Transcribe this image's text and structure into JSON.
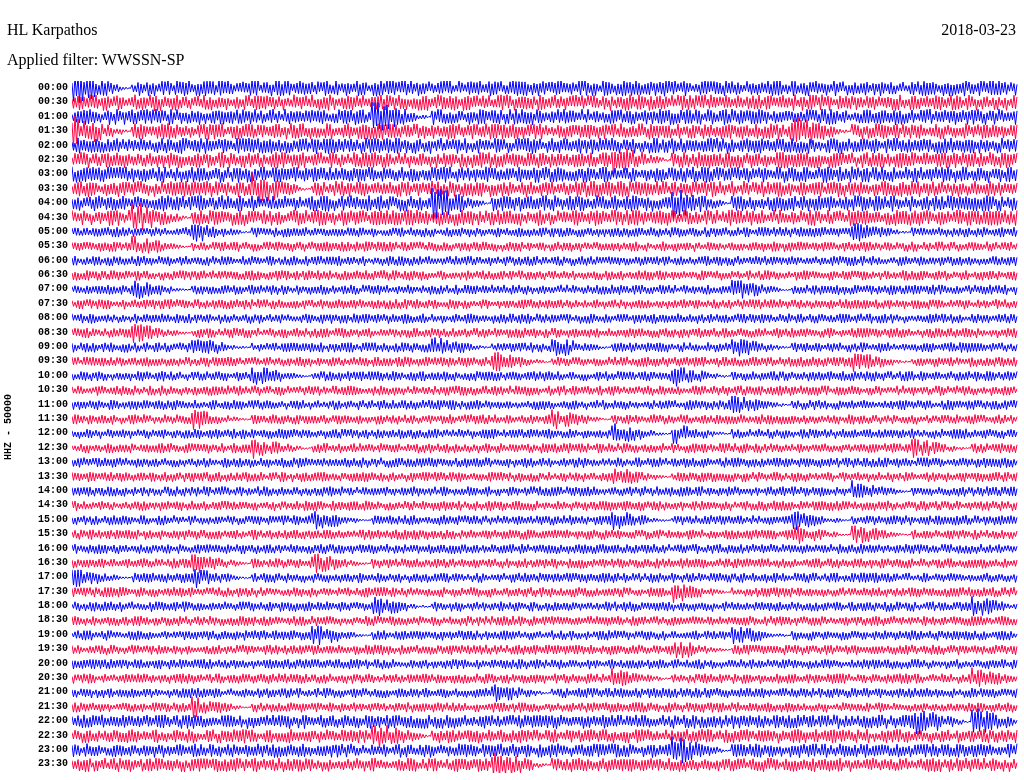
{
  "station": "HL Karpathos",
  "date": "2018-03-23",
  "filter": "Applied filter: WWSSN-SP",
  "axis_label": "HHZ - 50000",
  "traces": [
    {
      "time": "00:00",
      "color": "#0000ff"
    },
    {
      "time": "00:30",
      "color": "#ff0040"
    },
    {
      "time": "01:00",
      "color": "#0000ff"
    },
    {
      "time": "01:30",
      "color": "#ff0040"
    },
    {
      "time": "02:00",
      "color": "#0000ff"
    },
    {
      "time": "02:30",
      "color": "#ff0040"
    },
    {
      "time": "03:00",
      "color": "#0000ff"
    },
    {
      "time": "03:30",
      "color": "#ff0040"
    },
    {
      "time": "04:00",
      "color": "#0000ff"
    },
    {
      "time": "04:30",
      "color": "#ff0040"
    },
    {
      "time": "05:00",
      "color": "#0000ff"
    },
    {
      "time": "05:30",
      "color": "#ff0040"
    },
    {
      "time": "06:00",
      "color": "#0000ff"
    },
    {
      "time": "06:30",
      "color": "#ff0040"
    },
    {
      "time": "07:00",
      "color": "#0000ff"
    },
    {
      "time": "07:30",
      "color": "#ff0040"
    },
    {
      "time": "08:00",
      "color": "#0000ff"
    },
    {
      "time": "08:30",
      "color": "#ff0040"
    },
    {
      "time": "09:00",
      "color": "#0000ff"
    },
    {
      "time": "09:30",
      "color": "#ff0040"
    },
    {
      "time": "10:00",
      "color": "#0000ff"
    },
    {
      "time": "10:30",
      "color": "#ff0040"
    },
    {
      "time": "11:00",
      "color": "#0000ff"
    },
    {
      "time": "11:30",
      "color": "#ff0040"
    },
    {
      "time": "12:00",
      "color": "#0000ff"
    },
    {
      "time": "12:30",
      "color": "#ff0040"
    },
    {
      "time": "13:00",
      "color": "#0000ff"
    },
    {
      "time": "13:30",
      "color": "#ff0040"
    },
    {
      "time": "14:00",
      "color": "#0000ff"
    },
    {
      "time": "14:30",
      "color": "#ff0040"
    },
    {
      "time": "15:00",
      "color": "#0000ff"
    },
    {
      "time": "15:30",
      "color": "#ff0040"
    },
    {
      "time": "16:00",
      "color": "#0000ff"
    },
    {
      "time": "16:30",
      "color": "#ff0040"
    },
    {
      "time": "17:00",
      "color": "#0000ff"
    },
    {
      "time": "17:30",
      "color": "#ff0040"
    },
    {
      "time": "18:00",
      "color": "#0000ff"
    },
    {
      "time": "18:30",
      "color": "#ff0040"
    },
    {
      "time": "19:00",
      "color": "#0000ff"
    },
    {
      "time": "19:30",
      "color": "#ff0040"
    },
    {
      "time": "20:00",
      "color": "#0000ff"
    },
    {
      "time": "20:30",
      "color": "#ff0040"
    },
    {
      "time": "21:00",
      "color": "#0000ff"
    },
    {
      "time": "21:30",
      "color": "#ff0040"
    },
    {
      "time": "22:00",
      "color": "#0000ff"
    },
    {
      "time": "22:30",
      "color": "#ff0040"
    },
    {
      "time": "23:00",
      "color": "#0000ff"
    },
    {
      "time": "23:30",
      "color": "#ff0040"
    }
  ]
}
